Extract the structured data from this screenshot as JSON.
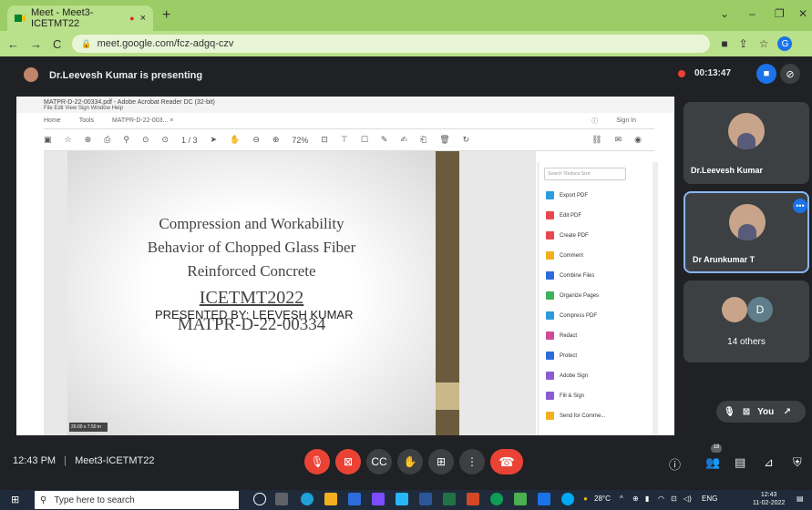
{
  "browser": {
    "tab_title": "Meet - Meet3-ICETMT22",
    "tab_recording_indicator": "●",
    "tab_close": "×",
    "new_tab": "+",
    "url": "meet.google.com/fcz-adgq-czv",
    "profile_initial": "G"
  },
  "meet": {
    "presenting_text": "Dr.Leevesh Kumar is presenting",
    "recording_timer": "00:13:47",
    "clock": "12:43 PM",
    "separator": "|",
    "meeting_name": "Meet3-ICETMT22",
    "others_count_label": "14 others",
    "others_initial": "D",
    "you_label": "You",
    "participants_badge": "18"
  },
  "participants": [
    {
      "name": "Dr.Leevesh Kumar"
    },
    {
      "name": "Dr Arunkumar T"
    }
  ],
  "acrobat": {
    "window_title": "MATPR-D-22-00334.pdf - Adobe Acrobat Reader DC (32-bit)",
    "menu": "File  Edit  View  Sign  Window  Help",
    "tabs": [
      "Home",
      "Tools",
      "MATPR-D-22-003...  ×"
    ],
    "sign_in": "Sign In",
    "page_indicator": "1 / 3",
    "zoom": "72%",
    "search_placeholder": "Search 'Reduce Size'",
    "page_size": "20.00 x 7.50 in",
    "tools": [
      {
        "label": "Export PDF",
        "color": "#2d9cdb"
      },
      {
        "label": "Edit PDF",
        "color": "#e8474c"
      },
      {
        "label": "Create PDF",
        "color": "#e8474c"
      },
      {
        "label": "Comment",
        "color": "#f2b01e"
      },
      {
        "label": "Combine Files",
        "color": "#2d6cdb"
      },
      {
        "label": "Organize Pages",
        "color": "#3db35a"
      },
      {
        "label": "Compress PDF",
        "color": "#2d9cdb"
      },
      {
        "label": "Redact",
        "color": "#d04a9a"
      },
      {
        "label": "Protect",
        "color": "#2d6cdb"
      },
      {
        "label": "Adobe Sign",
        "color": "#8a5cd0"
      },
      {
        "label": "Fill & Sign",
        "color": "#8a5cd0"
      },
      {
        "label": "Send for Comme...",
        "color": "#f2b01e"
      }
    ]
  },
  "slide": {
    "line1": "Compression and Workability",
    "line2": "Behavior of Chopped Glass Fiber",
    "line3": "Reinforced Concrete",
    "line4": "ICETMT2022",
    "line5": "MATPR-D-22-00334",
    "presented_by": "PRESENTED BY: LEEVESH KUMAR"
  },
  "taskbar": {
    "search_placeholder": "Type here to search",
    "weather": "28°C",
    "language": "ENG",
    "time": "12:43",
    "date": "11-02-2022"
  }
}
